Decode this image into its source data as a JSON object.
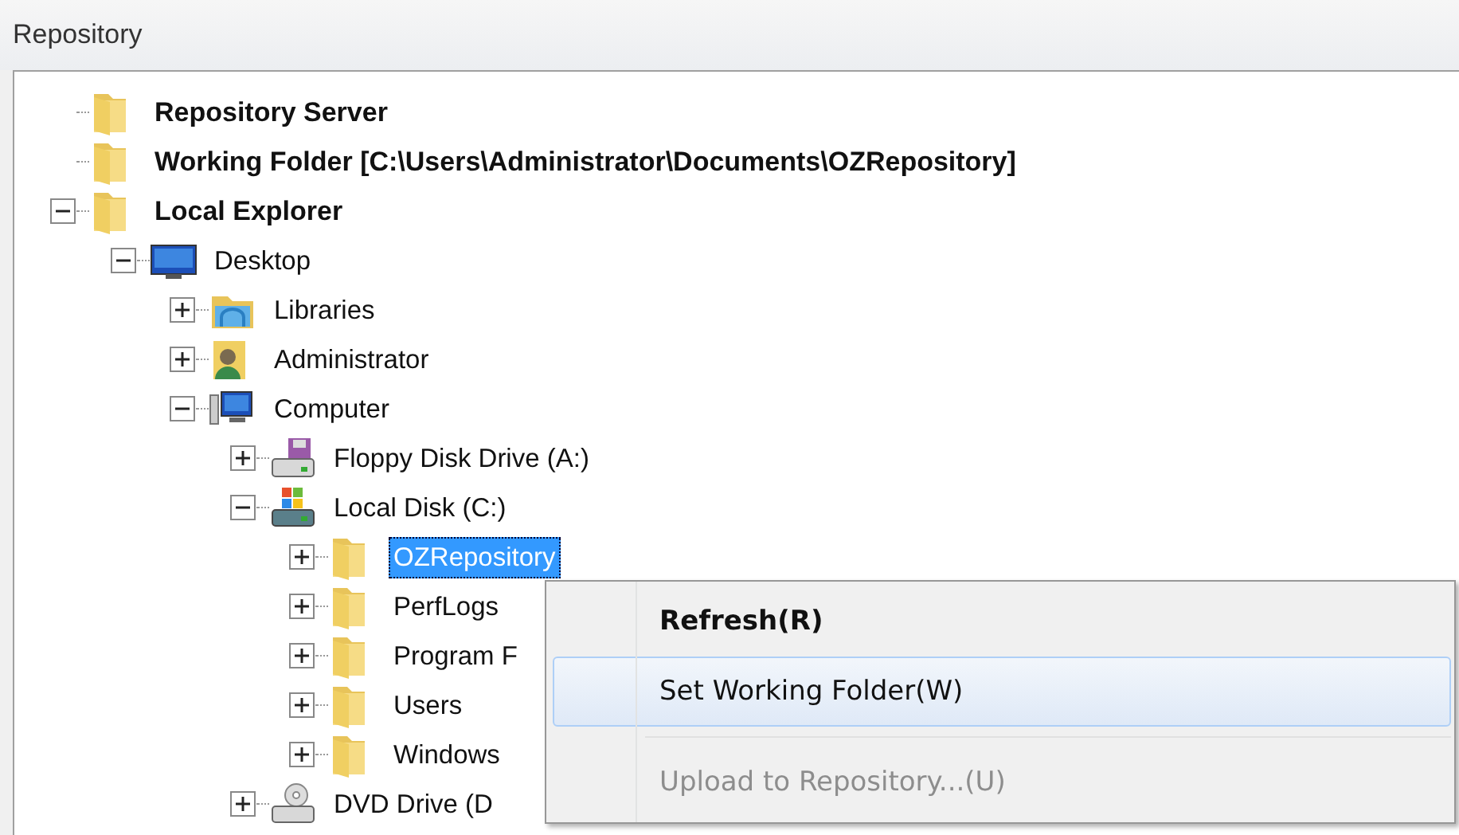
{
  "panel": {
    "title": "Repository"
  },
  "tree": [
    {
      "label": "Repository Server",
      "kind": "folder",
      "bold": true,
      "selected": false
    },
    {
      "label": "Working Folder [C:\\Users\\Administrator\\Documents\\OZRepository]",
      "kind": "folder",
      "bold": true,
      "selected": false
    },
    {
      "label": "Local Explorer",
      "kind": "folder",
      "bold": true,
      "selected": false,
      "expanded": true,
      "children": [
        {
          "label": "Desktop",
          "kind": "desktop",
          "bold": false,
          "selected": false,
          "expanded": true,
          "children": [
            {
              "label": "Libraries",
              "kind": "libraries",
              "bold": false,
              "selected": false,
              "expanded": false
            },
            {
              "label": "Administrator",
              "kind": "user",
              "bold": false,
              "selected": false,
              "expanded": false
            },
            {
              "label": "Computer",
              "kind": "computer",
              "bold": false,
              "selected": false,
              "expanded": true,
              "children": [
                {
                  "label": "Floppy Disk Drive (A:)",
                  "kind": "floppy",
                  "bold": false,
                  "selected": false,
                  "expanded": false
                },
                {
                  "label": "Local Disk (C:)",
                  "kind": "disk",
                  "bold": false,
                  "selected": false,
                  "expanded": true,
                  "children": [
                    {
                      "label": "OZRepository",
                      "kind": "folder",
                      "bold": false,
                      "selected": true,
                      "expanded": false
                    },
                    {
                      "label": "PerfLogs",
                      "kind": "folder",
                      "bold": false,
                      "selected": false,
                      "expanded": false
                    },
                    {
                      "label": "Program F",
                      "kind": "folder",
                      "bold": false,
                      "selected": false,
                      "expanded": false
                    },
                    {
                      "label": "Users",
                      "kind": "folder",
                      "bold": false,
                      "selected": false,
                      "expanded": false
                    },
                    {
                      "label": "Windows",
                      "kind": "folder",
                      "bold": false,
                      "selected": false,
                      "expanded": false
                    }
                  ]
                },
                {
                  "label": "DVD Drive (D",
                  "kind": "dvd",
                  "bold": false,
                  "selected": false,
                  "expanded": false
                }
              ]
            }
          ]
        }
      ]
    }
  ],
  "context_menu": [
    {
      "kind": "item",
      "label": "Refresh(R)",
      "default": true,
      "selected": false,
      "disabled": false
    },
    {
      "kind": "item",
      "label": "Set Working Folder(W)",
      "default": false,
      "selected": true,
      "disabled": false
    },
    {
      "kind": "separator"
    },
    {
      "kind": "item",
      "label": "Upload to Repository...(U)",
      "default": false,
      "selected": false,
      "disabled": true
    }
  ]
}
